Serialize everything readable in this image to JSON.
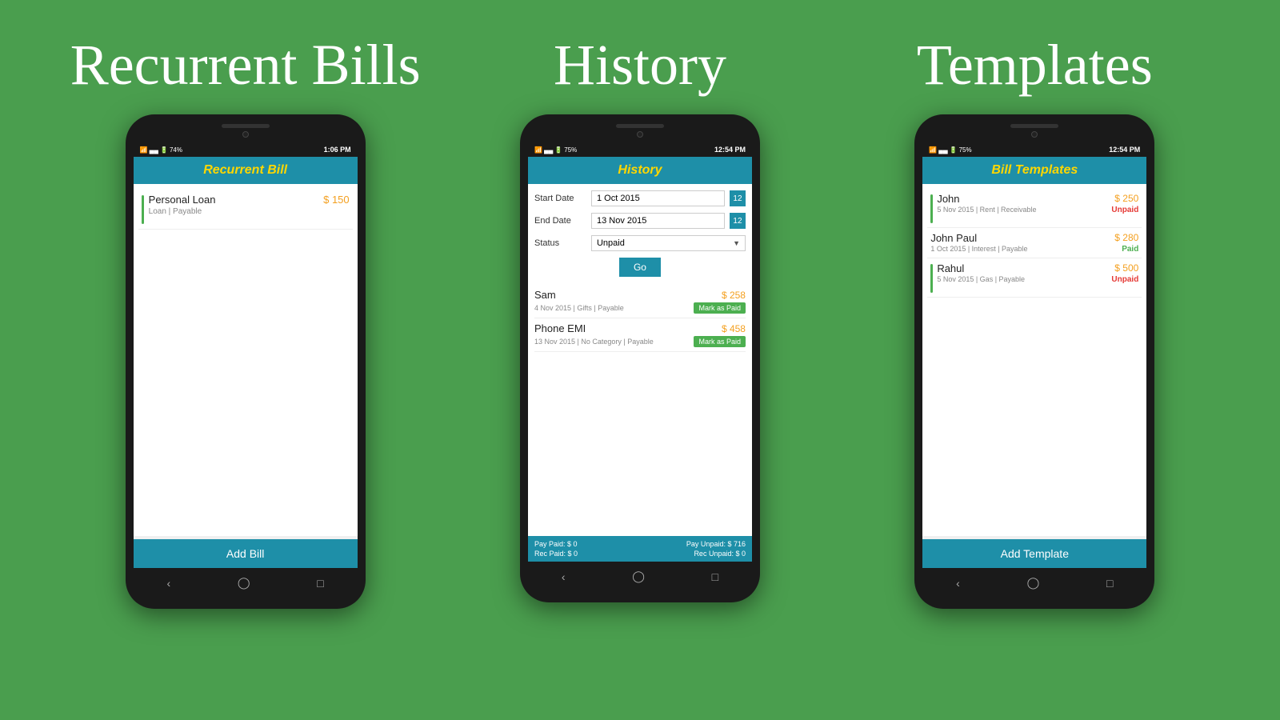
{
  "background_color": "#4a9e4e",
  "sections": [
    {
      "id": "recurrent-bills",
      "title": "Recurrent Bills",
      "phone": {
        "status_bar": {
          "wifi": "wifi",
          "signal": "signal",
          "battery": "74%",
          "time": "1:06 PM"
        },
        "header_title": "Recurrent Bill",
        "bills": [
          {
            "name": "Personal Loan",
            "sub": "Loan | Payable",
            "amount": "$ 150"
          }
        ],
        "add_button_label": "Add Bill"
      }
    },
    {
      "id": "history",
      "title": "History",
      "phone": {
        "status_bar": {
          "wifi": "wifi",
          "signal": "signal",
          "battery": "75%",
          "time": "12:54 PM"
        },
        "header_title": "History",
        "form": {
          "start_date_label": "Start Date",
          "start_date_value": "1 Oct 2015",
          "end_date_label": "End Date",
          "end_date_value": "13 Nov 2015",
          "status_label": "Status",
          "status_value": "Unpaid",
          "go_button": "Go"
        },
        "items": [
          {
            "name": "Sam",
            "sub": "4 Nov 2015 | Gifts | Payable",
            "amount": "$ 258",
            "action": "Mark as Paid"
          },
          {
            "name": "Phone EMI",
            "sub": "13 Nov 2015 | No Category | Payable",
            "amount": "$ 458",
            "action": "Mark as Paid"
          }
        ],
        "footer": {
          "pay_paid": "Pay Paid: $ 0",
          "pay_unpaid": "Pay Unpaid: $ 716",
          "rec_paid": "Rec Paid: $ 0",
          "rec_unpaid": "Rec Unpaid: $ 0"
        }
      }
    },
    {
      "id": "templates",
      "title": "Templates",
      "phone": {
        "status_bar": {
          "wifi": "wifi",
          "signal": "signal",
          "battery": "75%",
          "time": "12:54 PM"
        },
        "header_title": "Bill Templates",
        "templates": [
          {
            "name": "John",
            "sub": "5 Nov 2015 | Rent | Receivable",
            "amount": "$ 250",
            "status": "Unpaid",
            "status_type": "unpaid"
          },
          {
            "name": "John Paul",
            "sub": "1 Oct 2015 | Interest | Payable",
            "amount": "$ 280",
            "status": "Paid",
            "status_type": "paid"
          },
          {
            "name": "Rahul",
            "sub": "5 Nov 2015 | Gas | Payable",
            "amount": "$ 500",
            "status": "Unpaid",
            "status_type": "unpaid"
          }
        ],
        "add_button_label": "Add Template"
      }
    }
  ]
}
